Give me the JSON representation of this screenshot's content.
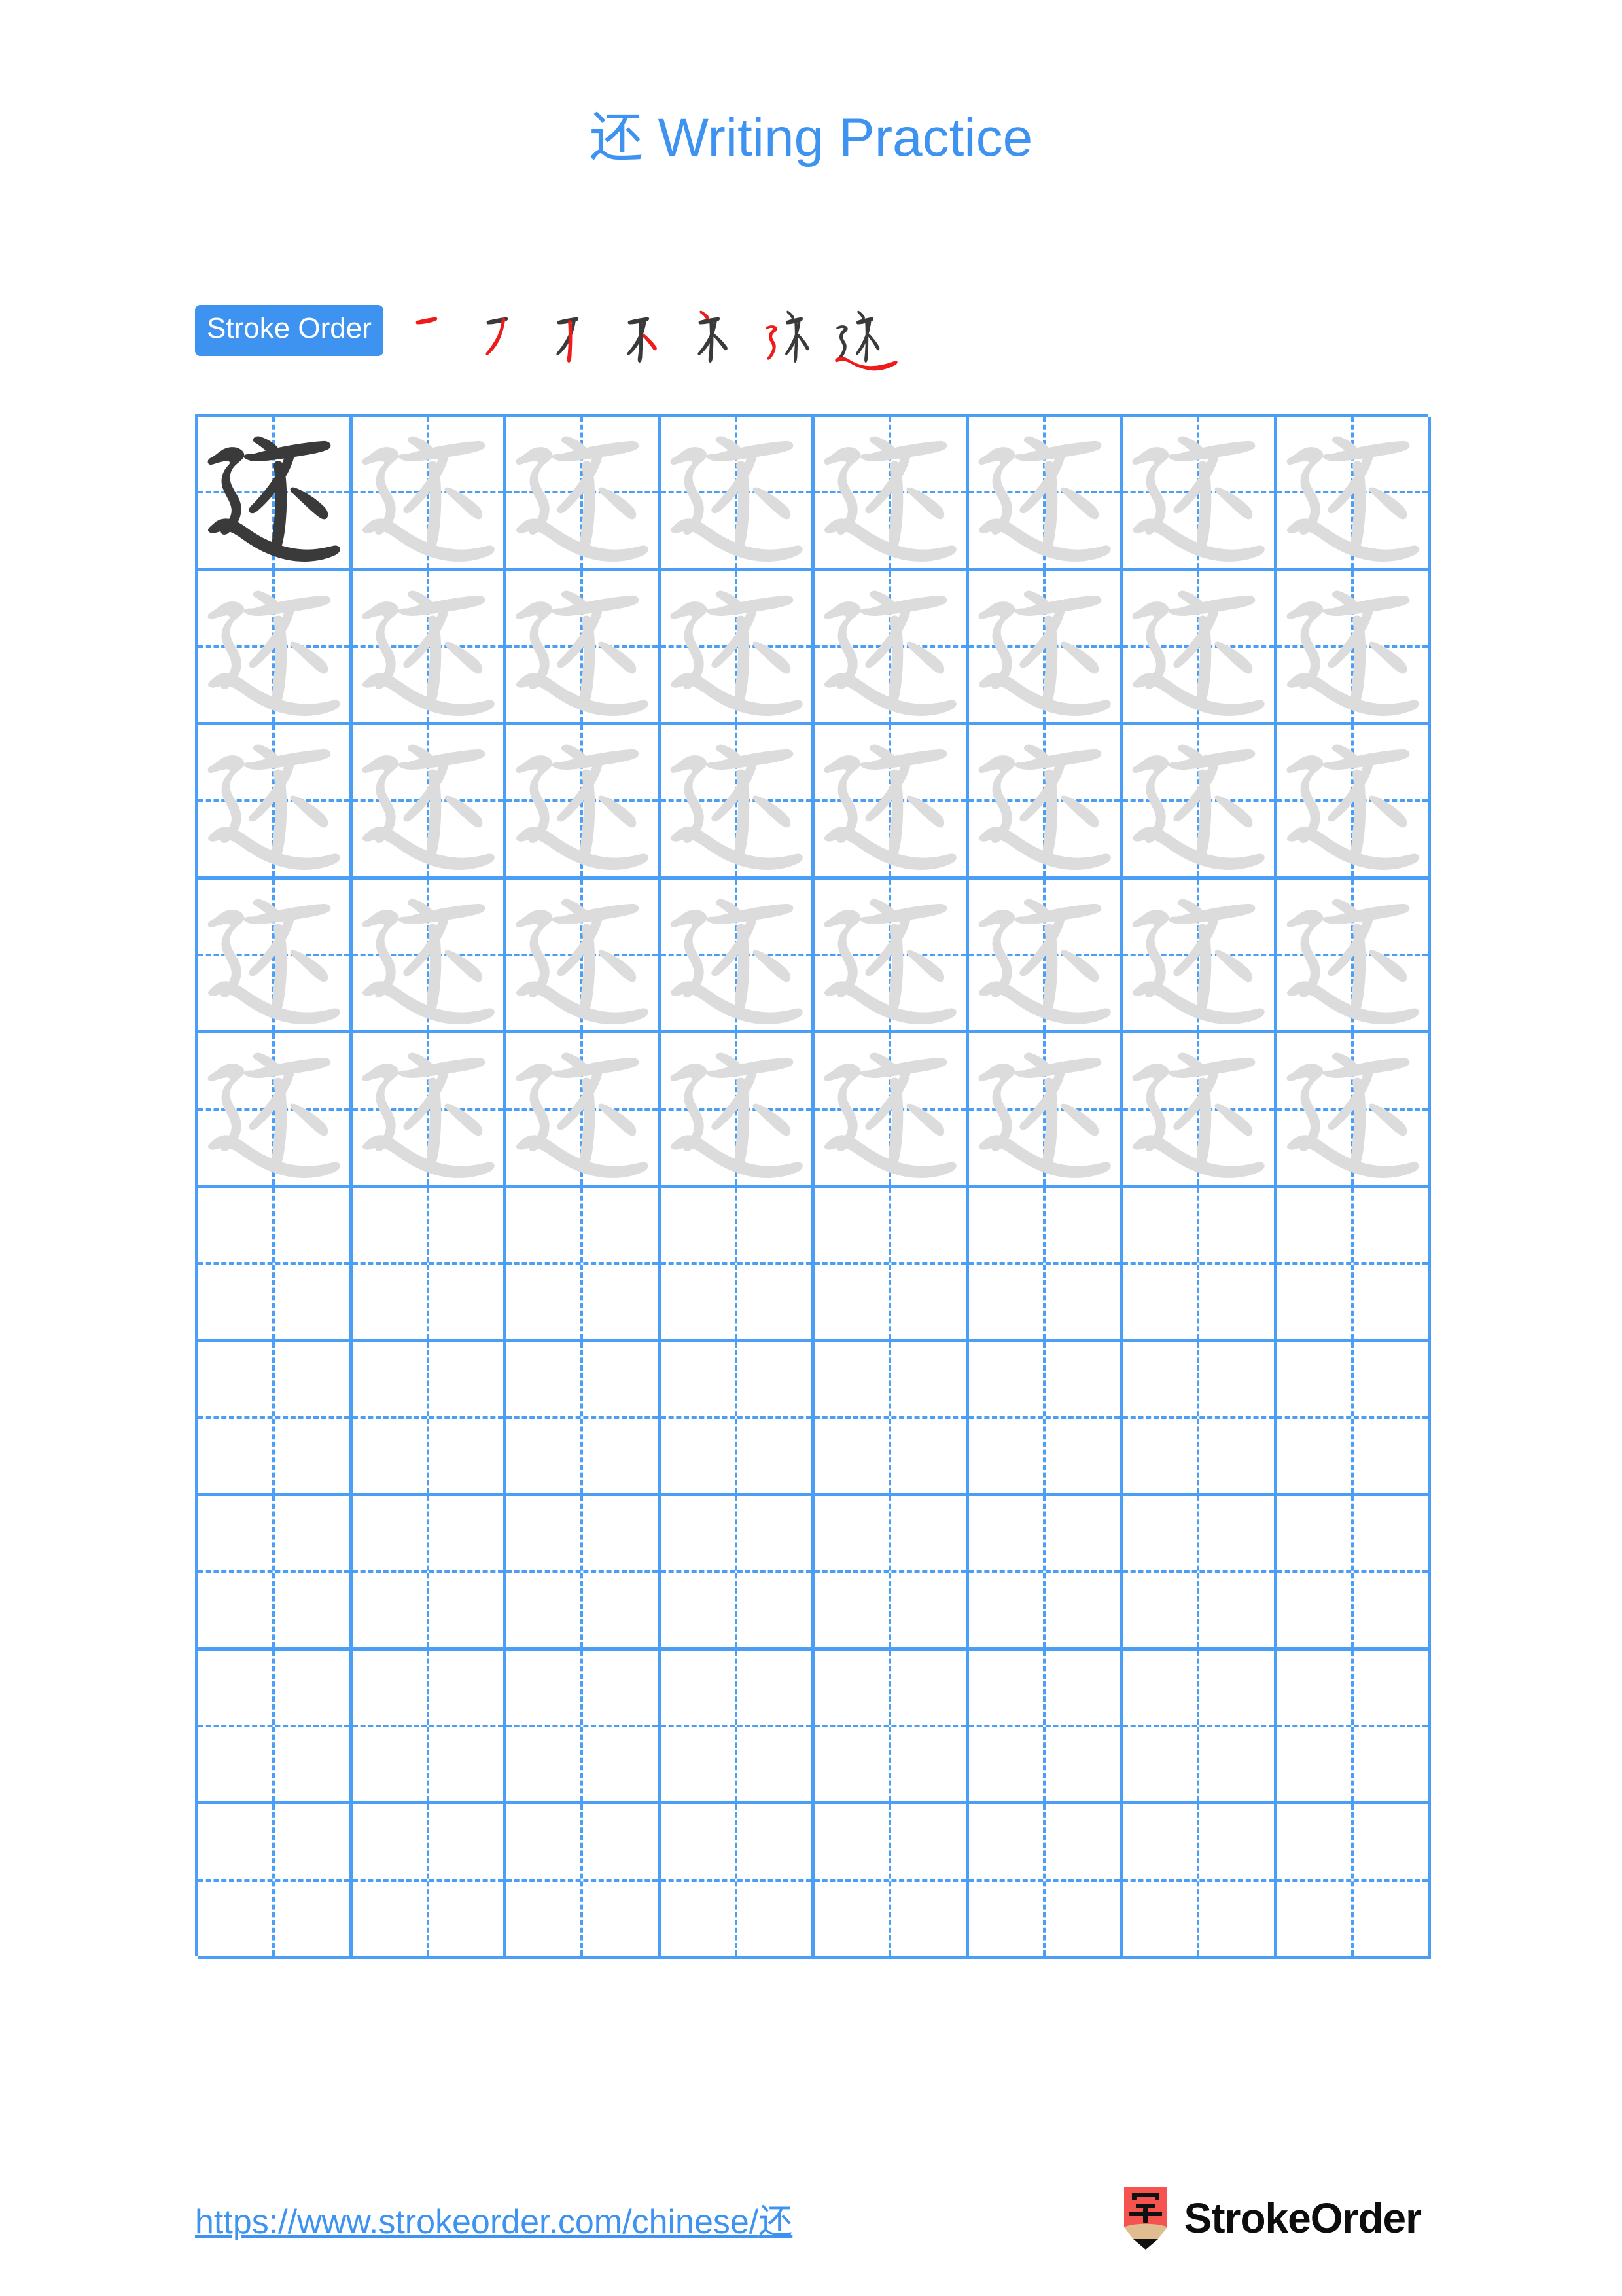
{
  "document": {
    "type": "chinese-character-writing-practice-worksheet",
    "character": "还",
    "title_prefix": "还",
    "title_suffix": " Writing Practice",
    "title_full": "还 Writing Practice",
    "page_background": "#ffffff"
  },
  "colors": {
    "accent_blue": "#3d93ef",
    "grid_blue": "#4a9ef5",
    "model_char_dark": "#3a3a3a",
    "trace_char_gray": "#dcdcdc",
    "stroke_new_red": "#ee1b1b",
    "stroke_done_dark": "#3a3a3a",
    "brand_black": "#0d0d0d",
    "pencil_red": "#f4534f",
    "pencil_wood": "#e0bd90"
  },
  "stroke_order": {
    "badge_label": "Stroke Order",
    "step_count": 7,
    "steps": [
      {
        "index": 1,
        "new_stroke": "横 (héng)",
        "cumulative": "一"
      },
      {
        "index": 2,
        "new_stroke": "撇 (piě)",
        "cumulative": "𠃌"
      },
      {
        "index": 3,
        "new_stroke": "竖 (shù)",
        "cumulative": "丆"
      },
      {
        "index": 4,
        "new_stroke": "点 (diǎn)",
        "cumulative": "不"
      },
      {
        "index": 5,
        "new_stroke": "点 (diǎn)",
        "cumulative": "不"
      },
      {
        "index": 6,
        "new_stroke": "横折折撇 (héngzhézhépiě)",
        "cumulative": "还"
      },
      {
        "index": 7,
        "new_stroke": "捺 (nà)",
        "cumulative": "还"
      }
    ]
  },
  "grid": {
    "columns": 8,
    "rows": 10,
    "filled_rows": 5,
    "empty_rows": 5,
    "model_cell": {
      "row": 1,
      "column": 1,
      "style": "dark"
    },
    "trace_style": "gray",
    "rows_data": [
      {
        "row": 1,
        "cells": [
          "model",
          "trace",
          "trace",
          "trace",
          "trace",
          "trace",
          "trace",
          "trace"
        ]
      },
      {
        "row": 2,
        "cells": [
          "trace",
          "trace",
          "trace",
          "trace",
          "trace",
          "trace",
          "trace",
          "trace"
        ]
      },
      {
        "row": 3,
        "cells": [
          "trace",
          "trace",
          "trace",
          "trace",
          "trace",
          "trace",
          "trace",
          "trace"
        ]
      },
      {
        "row": 4,
        "cells": [
          "trace",
          "trace",
          "trace",
          "trace",
          "trace",
          "trace",
          "trace",
          "trace"
        ]
      },
      {
        "row": 5,
        "cells": [
          "trace",
          "trace",
          "trace",
          "trace",
          "trace",
          "trace",
          "trace",
          "trace"
        ]
      },
      {
        "row": 6,
        "cells": [
          "empty",
          "empty",
          "empty",
          "empty",
          "empty",
          "empty",
          "empty",
          "empty"
        ]
      },
      {
        "row": 7,
        "cells": [
          "empty",
          "empty",
          "empty",
          "empty",
          "empty",
          "empty",
          "empty",
          "empty"
        ]
      },
      {
        "row": 8,
        "cells": [
          "empty",
          "empty",
          "empty",
          "empty",
          "empty",
          "empty",
          "empty",
          "empty"
        ]
      },
      {
        "row": 9,
        "cells": [
          "empty",
          "empty",
          "empty",
          "empty",
          "empty",
          "empty",
          "empty",
          "empty"
        ]
      },
      {
        "row": 10,
        "cells": [
          "empty",
          "empty",
          "empty",
          "empty",
          "empty",
          "empty",
          "empty",
          "empty"
        ]
      }
    ]
  },
  "footer": {
    "url": "https://www.strokeorder.com/chinese/还",
    "url_prefix": "https://www.strokeorder.com/chinese/",
    "url_character": "还",
    "brand_name": "StrokeOrder",
    "brand_icon_character": "字"
  }
}
